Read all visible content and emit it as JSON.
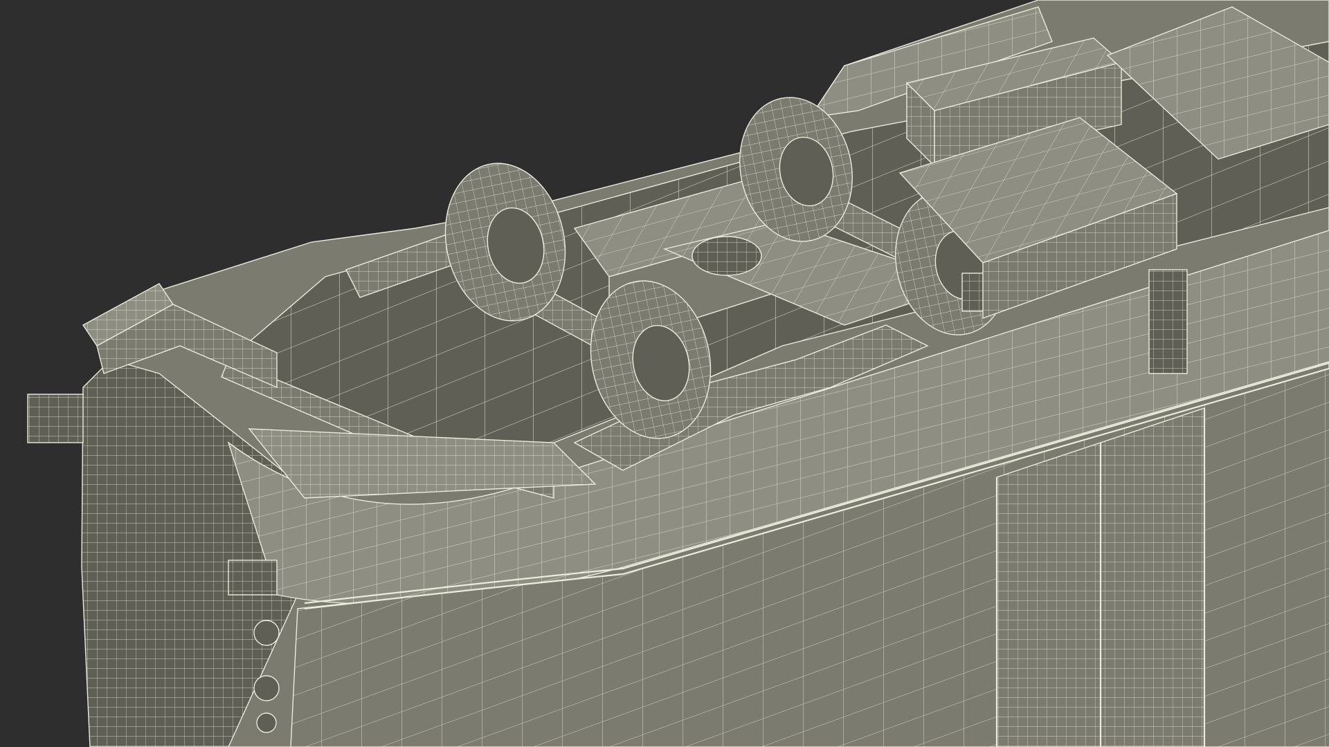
{
  "render": {
    "background_color": "#2e2e2e",
    "mesh_fill_color": "#7b7b70",
    "mesh_shade_color": "#5f5f56",
    "mesh_light_color": "#8e8e83",
    "wire_color": "#ecebdc",
    "subject": "wireframe-3d-model-railcar-underside",
    "components": [
      "car-body-shell",
      "front-coupler",
      "bogie",
      "wheelset",
      "wheelset",
      "wheelset",
      "wheelset",
      "equipment-box",
      "equipment-box",
      "air-tank",
      "side-doors",
      "vent-grilles"
    ]
  }
}
